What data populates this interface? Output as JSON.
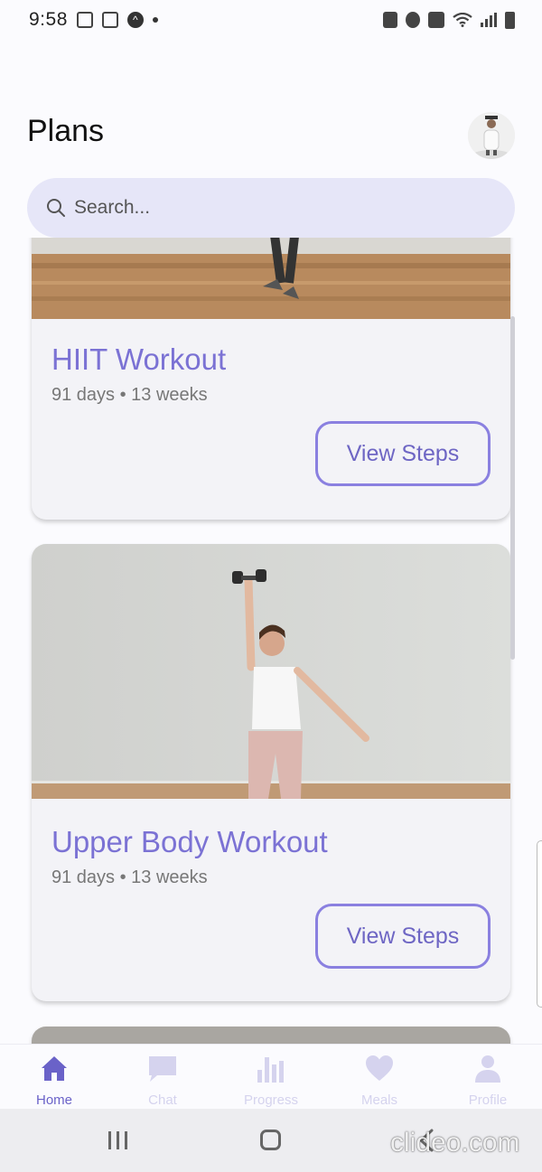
{
  "status_bar": {
    "time": "9:58"
  },
  "header": {
    "title": "Plans"
  },
  "search": {
    "placeholder": "Search..."
  },
  "plans": [
    {
      "title": "HIIT Workout",
      "meta": "91 days • 13 weeks",
      "button_label": "View Steps"
    },
    {
      "title": "Upper Body Workout",
      "meta": "91 days • 13 weeks",
      "button_label": "View Steps"
    }
  ],
  "bottom_nav": {
    "items": [
      {
        "label": "Home",
        "icon": "home-icon",
        "active": true
      },
      {
        "label": "Chat",
        "icon": "chat-icon",
        "active": false
      },
      {
        "label": "Progress",
        "icon": "bar-chart-icon",
        "active": false
      },
      {
        "label": "Meals",
        "icon": "heart-icon",
        "active": false
      },
      {
        "label": "Profile",
        "icon": "person-icon",
        "active": false
      }
    ]
  },
  "watermark": "clideo.com",
  "colors": {
    "accent": "#7b72d4",
    "search_bg": "#e6e6f8",
    "card_bg": "#f3f3f7",
    "nav_inactive": "#d5d3ee"
  }
}
